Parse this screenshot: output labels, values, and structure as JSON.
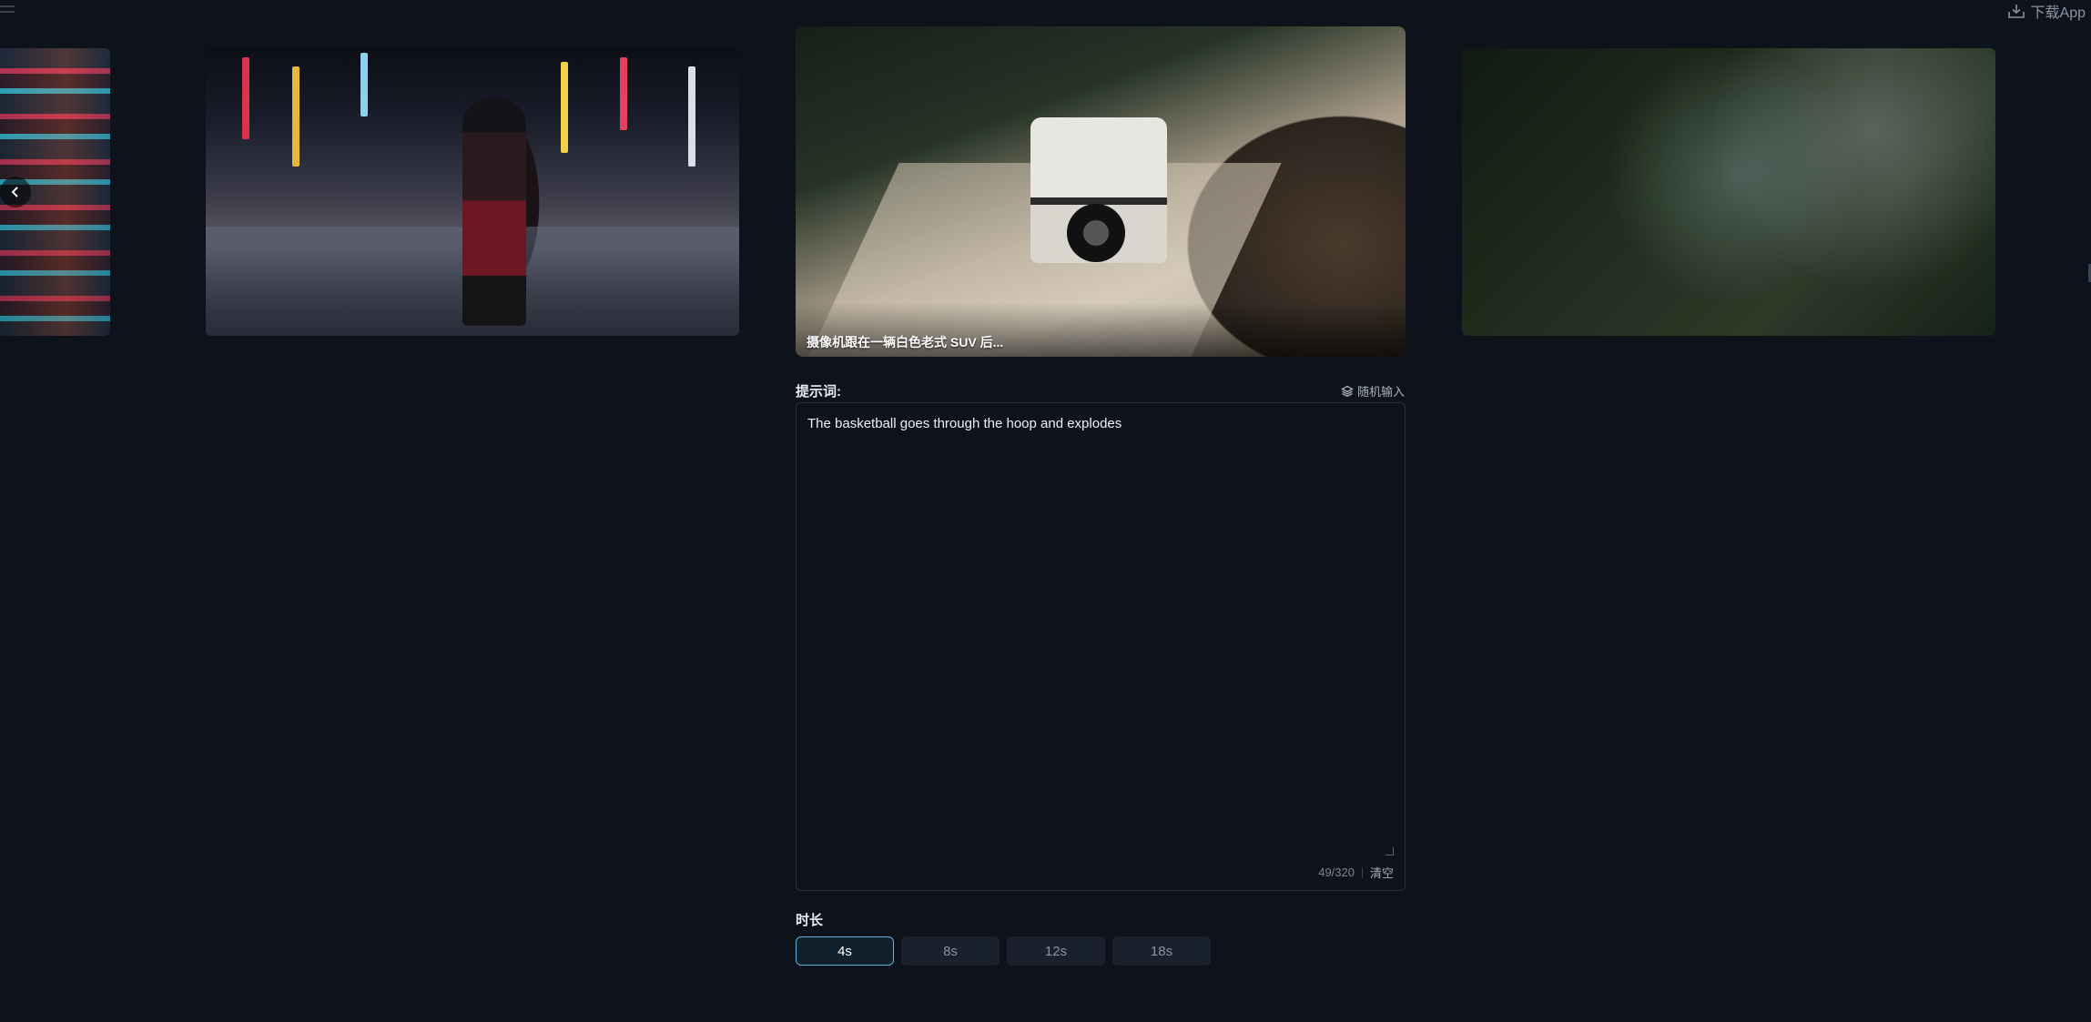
{
  "header": {
    "download_label": "下载App",
    "menu_icon": "menu-icon",
    "download_icon": "download-icon"
  },
  "carousel": {
    "items": [
      {
        "id": "neon-city-left",
        "caption": ""
      },
      {
        "id": "woman-street",
        "caption": ""
      },
      {
        "id": "suv",
        "caption": "摄像机跟在一辆白色老式 SUV 后..."
      },
      {
        "id": "foliage",
        "caption": ""
      }
    ],
    "prev_icon": "chevron-left-icon"
  },
  "prompt": {
    "label": "提示词:",
    "random_label": "随机输入",
    "value": "The basketball goes through the hoop and explodes",
    "counter": "49/320",
    "clear_label": "清空"
  },
  "duration": {
    "label": "时长",
    "options": [
      "4s",
      "8s",
      "12s",
      "18s"
    ],
    "selected": "4s"
  },
  "colors": {
    "background": "#0e131b",
    "accent": "#5fb7d8"
  }
}
